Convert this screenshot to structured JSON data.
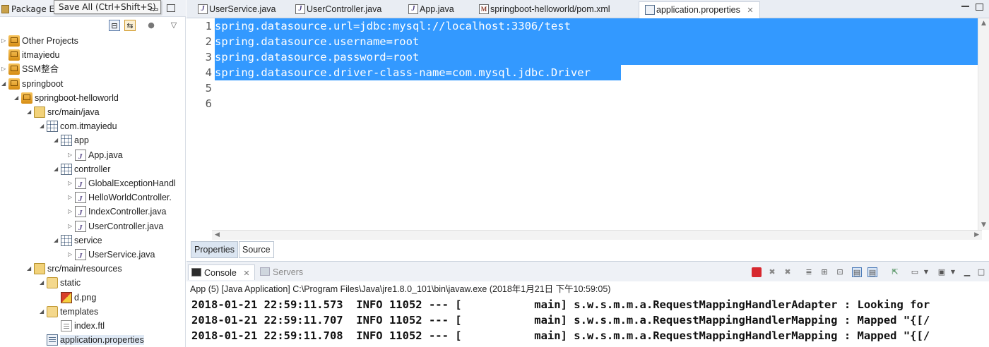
{
  "package_explorer": {
    "tab_label": "Package E",
    "tooltip": "Save All (Ctrl+Shift+S)",
    "tree": [
      {
        "label": "Other Projects",
        "icon": "project-icon",
        "twisty": "▷",
        "depth": 0
      },
      {
        "label": "itmayiedu",
        "icon": "project-icon",
        "twisty": "",
        "depth": 0
      },
      {
        "label": "SSM整合",
        "icon": "project-icon",
        "twisty": "▷",
        "depth": 0
      },
      {
        "label": "springboot",
        "icon": "project-icon",
        "twisty": "◢",
        "depth": 0
      },
      {
        "label": "springboot-helloworld",
        "icon": "maven-project-icon",
        "twisty": "◢",
        "depth": 1
      },
      {
        "label": "src/main/java",
        "icon": "source-folder-icon",
        "twisty": "◢",
        "depth": 2
      },
      {
        "label": "com.itmayiedu",
        "icon": "package-icon",
        "twisty": "◢",
        "depth": 3
      },
      {
        "label": "app",
        "icon": "package-icon",
        "twisty": "◢",
        "depth": 4
      },
      {
        "label": "App.java",
        "icon": "java-file-icon",
        "twisty": "▷",
        "depth": 5
      },
      {
        "label": "controller",
        "icon": "package-icon",
        "twisty": "◢",
        "depth": 4
      },
      {
        "label": "GlobalExceptionHandl",
        "icon": "java-file-icon",
        "twisty": "▷",
        "depth": 5
      },
      {
        "label": "HelloWorldController.",
        "icon": "java-file-icon",
        "twisty": "▷",
        "depth": 5
      },
      {
        "label": "IndexController.java",
        "icon": "java-file-icon",
        "twisty": "▷",
        "depth": 5
      },
      {
        "label": "UserController.java",
        "icon": "java-file-icon",
        "twisty": "▷",
        "depth": 5
      },
      {
        "label": "service",
        "icon": "package-icon",
        "twisty": "◢",
        "depth": 4
      },
      {
        "label": "UserService.java",
        "icon": "java-file-icon",
        "twisty": "▷",
        "depth": 5
      },
      {
        "label": "src/main/resources",
        "icon": "source-folder-icon",
        "twisty": "◢",
        "depth": 2
      },
      {
        "label": "static",
        "icon": "folder-icon",
        "twisty": "◢",
        "depth": 3
      },
      {
        "label": "d.png",
        "icon": "image-file-icon",
        "twisty": "",
        "depth": 4
      },
      {
        "label": "templates",
        "icon": "folder-icon",
        "twisty": "◢",
        "depth": 3
      },
      {
        "label": "index.ftl",
        "icon": "text-file-icon",
        "twisty": "",
        "depth": 4
      },
      {
        "label": "application.properties",
        "icon": "properties-file-icon",
        "twisty": "",
        "depth": 3
      }
    ]
  },
  "editor": {
    "tabs": [
      {
        "label": "UserService.java",
        "icon": "java-file-icon",
        "active": false
      },
      {
        "label": "UserController.java",
        "icon": "java-file-icon",
        "active": false
      },
      {
        "label": "App.java",
        "icon": "java-file-icon",
        "active": false
      },
      {
        "label": "springboot-helloworld/pom.xml",
        "icon": "xml-file-icon",
        "active": false
      },
      {
        "label": "application.properties",
        "icon": "properties-file-icon",
        "active": true,
        "close": "✕"
      }
    ],
    "lines": [
      {
        "number": "1",
        "text": "spring.datasource.url=jdbc:mysql://localhost:3306/test"
      },
      {
        "number": "2",
        "text": "spring.datasource.username=root"
      },
      {
        "number": "3",
        "text": "spring.datasource.password=root"
      },
      {
        "number": "4",
        "text": "spring.datasource.driver-class-name=com.mysql.jdbc.Driver"
      },
      {
        "number": "5",
        "text": ""
      },
      {
        "number": "6",
        "text": ""
      }
    ],
    "selected_lines": [
      1,
      2,
      3,
      4
    ],
    "selection_color": "#3399ff",
    "bottom_tabs": [
      {
        "label": "Properties",
        "active": false
      },
      {
        "label": "Source",
        "active": true
      }
    ]
  },
  "console": {
    "tabs": [
      {
        "label": "Console",
        "active": true,
        "close": "✕"
      },
      {
        "label": "Servers",
        "active": false
      }
    ],
    "description": "App (5) [Java Application] C:\\Program Files\\Java\\jre1.8.0_101\\bin\\javaw.exe (2018年1月21日 下午10:59:05)",
    "log_lines": [
      "2018-01-21 22:59:11.573  INFO 11052 --- [           main] s.w.s.m.m.a.RequestMappingHandlerAdapter : Looking for",
      "2018-01-21 22:59:11.707  INFO 11052 --- [           main] s.w.s.m.m.a.RequestMappingHandlerMapping : Mapped \"{[/",
      "2018-01-21 22:59:11.708  INFO 11052 --- [           main] s.w.s.m.m.a.RequestMappingHandlerMapping : Mapped \"{[/"
    ],
    "terminate_color": "#d7282f"
  }
}
